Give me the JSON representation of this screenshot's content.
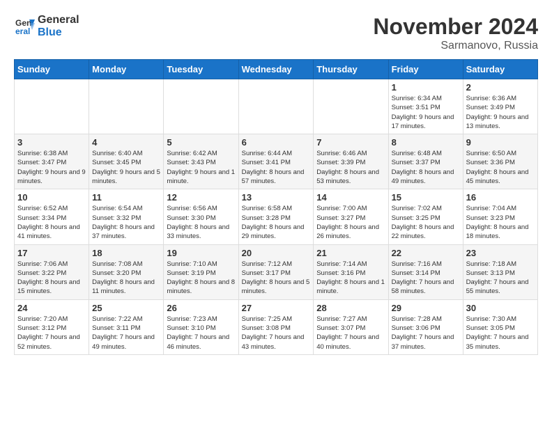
{
  "logo": {
    "general": "General",
    "blue": "Blue"
  },
  "header": {
    "month": "November 2024",
    "location": "Sarmanovo, Russia"
  },
  "weekdays": [
    "Sunday",
    "Monday",
    "Tuesday",
    "Wednesday",
    "Thursday",
    "Friday",
    "Saturday"
  ],
  "weeks": [
    [
      {
        "day": "",
        "content": ""
      },
      {
        "day": "",
        "content": ""
      },
      {
        "day": "",
        "content": ""
      },
      {
        "day": "",
        "content": ""
      },
      {
        "day": "",
        "content": ""
      },
      {
        "day": "1",
        "content": "Sunrise: 6:34 AM\nSunset: 3:51 PM\nDaylight: 9 hours and 17 minutes."
      },
      {
        "day": "2",
        "content": "Sunrise: 6:36 AM\nSunset: 3:49 PM\nDaylight: 9 hours and 13 minutes."
      }
    ],
    [
      {
        "day": "3",
        "content": "Sunrise: 6:38 AM\nSunset: 3:47 PM\nDaylight: 9 hours and 9 minutes."
      },
      {
        "day": "4",
        "content": "Sunrise: 6:40 AM\nSunset: 3:45 PM\nDaylight: 9 hours and 5 minutes."
      },
      {
        "day": "5",
        "content": "Sunrise: 6:42 AM\nSunset: 3:43 PM\nDaylight: 9 hours and 1 minute."
      },
      {
        "day": "6",
        "content": "Sunrise: 6:44 AM\nSunset: 3:41 PM\nDaylight: 8 hours and 57 minutes."
      },
      {
        "day": "7",
        "content": "Sunrise: 6:46 AM\nSunset: 3:39 PM\nDaylight: 8 hours and 53 minutes."
      },
      {
        "day": "8",
        "content": "Sunrise: 6:48 AM\nSunset: 3:37 PM\nDaylight: 8 hours and 49 minutes."
      },
      {
        "day": "9",
        "content": "Sunrise: 6:50 AM\nSunset: 3:36 PM\nDaylight: 8 hours and 45 minutes."
      }
    ],
    [
      {
        "day": "10",
        "content": "Sunrise: 6:52 AM\nSunset: 3:34 PM\nDaylight: 8 hours and 41 minutes."
      },
      {
        "day": "11",
        "content": "Sunrise: 6:54 AM\nSunset: 3:32 PM\nDaylight: 8 hours and 37 minutes."
      },
      {
        "day": "12",
        "content": "Sunrise: 6:56 AM\nSunset: 3:30 PM\nDaylight: 8 hours and 33 minutes."
      },
      {
        "day": "13",
        "content": "Sunrise: 6:58 AM\nSunset: 3:28 PM\nDaylight: 8 hours and 29 minutes."
      },
      {
        "day": "14",
        "content": "Sunrise: 7:00 AM\nSunset: 3:27 PM\nDaylight: 8 hours and 26 minutes."
      },
      {
        "day": "15",
        "content": "Sunrise: 7:02 AM\nSunset: 3:25 PM\nDaylight: 8 hours and 22 minutes."
      },
      {
        "day": "16",
        "content": "Sunrise: 7:04 AM\nSunset: 3:23 PM\nDaylight: 8 hours and 18 minutes."
      }
    ],
    [
      {
        "day": "17",
        "content": "Sunrise: 7:06 AM\nSunset: 3:22 PM\nDaylight: 8 hours and 15 minutes."
      },
      {
        "day": "18",
        "content": "Sunrise: 7:08 AM\nSunset: 3:20 PM\nDaylight: 8 hours and 11 minutes."
      },
      {
        "day": "19",
        "content": "Sunrise: 7:10 AM\nSunset: 3:19 PM\nDaylight: 8 hours and 8 minutes."
      },
      {
        "day": "20",
        "content": "Sunrise: 7:12 AM\nSunset: 3:17 PM\nDaylight: 8 hours and 5 minutes."
      },
      {
        "day": "21",
        "content": "Sunrise: 7:14 AM\nSunset: 3:16 PM\nDaylight: 8 hours and 1 minute."
      },
      {
        "day": "22",
        "content": "Sunrise: 7:16 AM\nSunset: 3:14 PM\nDaylight: 7 hours and 58 minutes."
      },
      {
        "day": "23",
        "content": "Sunrise: 7:18 AM\nSunset: 3:13 PM\nDaylight: 7 hours and 55 minutes."
      }
    ],
    [
      {
        "day": "24",
        "content": "Sunrise: 7:20 AM\nSunset: 3:12 PM\nDaylight: 7 hours and 52 minutes."
      },
      {
        "day": "25",
        "content": "Sunrise: 7:22 AM\nSunset: 3:11 PM\nDaylight: 7 hours and 49 minutes."
      },
      {
        "day": "26",
        "content": "Sunrise: 7:23 AM\nSunset: 3:10 PM\nDaylight: 7 hours and 46 minutes."
      },
      {
        "day": "27",
        "content": "Sunrise: 7:25 AM\nSunset: 3:08 PM\nDaylight: 7 hours and 43 minutes."
      },
      {
        "day": "28",
        "content": "Sunrise: 7:27 AM\nSunset: 3:07 PM\nDaylight: 7 hours and 40 minutes."
      },
      {
        "day": "29",
        "content": "Sunrise: 7:28 AM\nSunset: 3:06 PM\nDaylight: 7 hours and 37 minutes."
      },
      {
        "day": "30",
        "content": "Sunrise: 7:30 AM\nSunset: 3:05 PM\nDaylight: 7 hours and 35 minutes."
      }
    ]
  ]
}
